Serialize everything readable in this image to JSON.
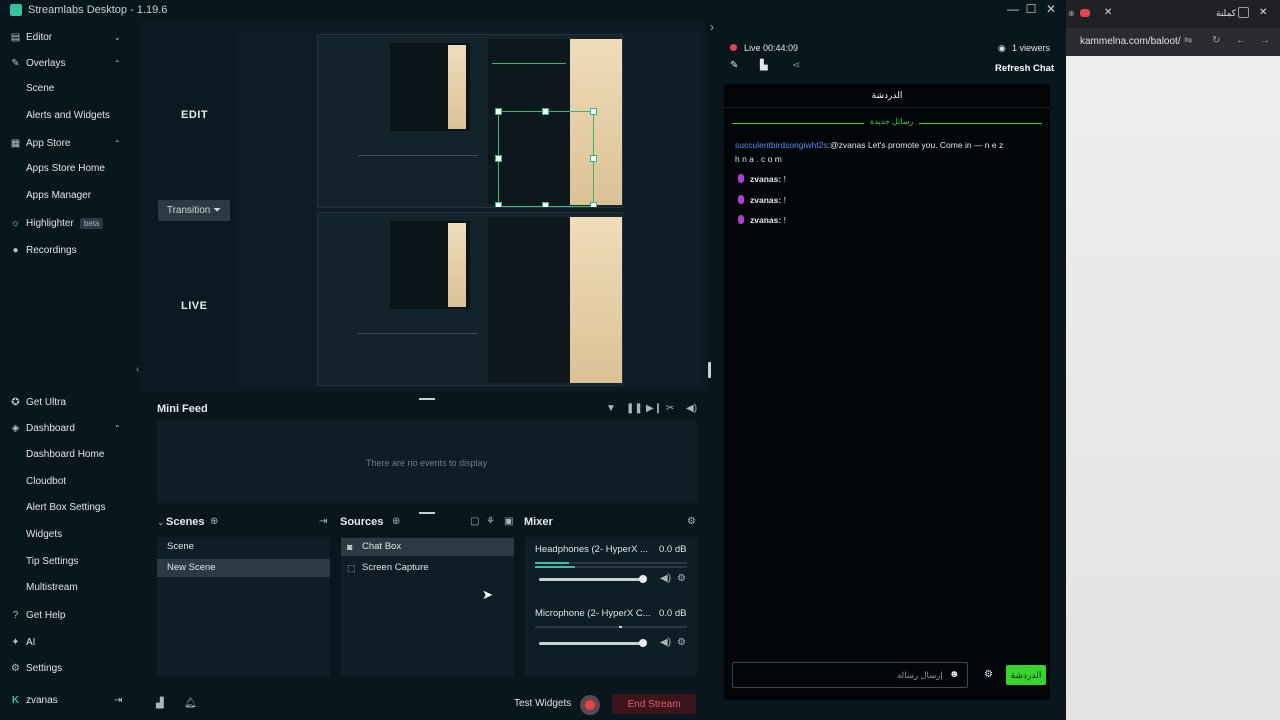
{
  "window": {
    "title": "Streamlabs Desktop - 1.19.6",
    "controls": {
      "minimize": "—",
      "maximize": "☐",
      "close": "✕"
    }
  },
  "sidebar": {
    "editor": "Editor",
    "overlays": "Overlays",
    "overlays_items": [
      "Scene",
      "Alerts and Widgets"
    ],
    "app_store": "App Store",
    "app_store_items": [
      "Apps Store Home",
      "Apps Manager"
    ],
    "highlighter": "Highlighter",
    "highlighter_badge": "beta",
    "recordings": "Recordings",
    "get_ultra": "Get Ultra",
    "dashboard": "Dashboard",
    "dashboard_items": [
      "Dashboard Home",
      "Cloudbot",
      "Alert Box Settings",
      "Widgets",
      "Tip Settings",
      "Multistream"
    ],
    "get_help": "Get Help",
    "ai": "AI",
    "settings": "Settings",
    "user": "zvanas"
  },
  "editor": {
    "edit_label": "EDIT",
    "live_label": "LIVE",
    "transition_button": "Transition ⏷"
  },
  "minifeed": {
    "title": "Mini Feed",
    "empty": "There are no events to display"
  },
  "scenes": {
    "title": "Scenes",
    "items": [
      "Scene",
      "New Scene"
    ]
  },
  "sources": {
    "title": "Sources",
    "items": [
      "Chat Box",
      "Screen Capture"
    ]
  },
  "mixer": {
    "title": "Mixer",
    "channels": [
      {
        "name": "Headphones (2- HyperX ...",
        "db": "0.0 dB",
        "level": 1.0
      },
      {
        "name": "Microphone (2- HyperX C...",
        "db": "0.0 dB",
        "level": 1.0
      }
    ]
  },
  "bottombar": {
    "test_widgets": "Test Widgets",
    "end_stream": "End Stream"
  },
  "chat": {
    "live_status": "Live 00:44:09",
    "viewers": "1 viewers",
    "refresh": "Refresh Chat",
    "header_title": "الدردشة",
    "new_messages_divider": "رسائل جديدة",
    "first_message_user": "succulentbirdsongiwht2s",
    "first_message_text": ":@zvanas Let's promote you. Come in — n e z",
    "first_message_cont": "h n a . c o m",
    "messages": [
      {
        "user": "zvanas:",
        "text": "!"
      },
      {
        "user": "zvanas:",
        "text": "!"
      },
      {
        "user": "zvanas:",
        "text": "!"
      }
    ],
    "input_placeholder": "إرسال رسالة",
    "send_button": "الدردشة"
  },
  "browser": {
    "tab_text": "كملنة",
    "url": "kammelna.com/baloot/"
  },
  "colors": {
    "accent": "#31c3a2",
    "live": "#e8424f",
    "chat_send": "#37d42f",
    "chat_user_link": "#4a8ff0"
  }
}
